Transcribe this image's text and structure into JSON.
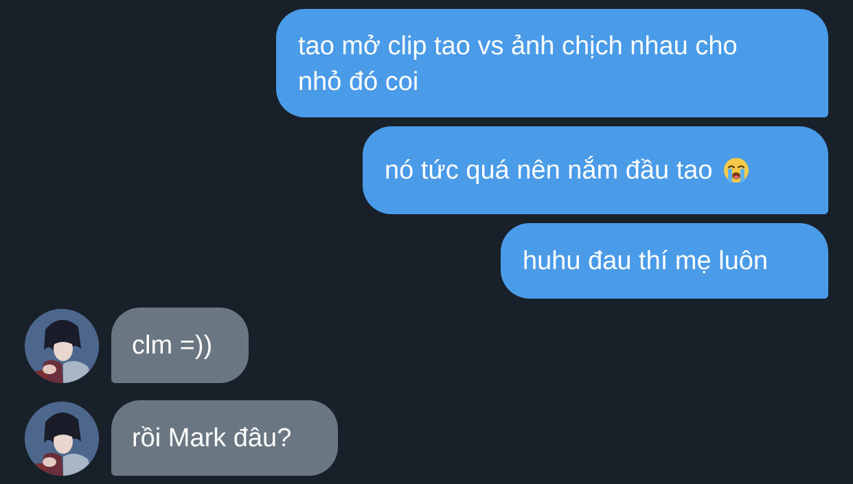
{
  "messages": {
    "out1": "tao mở clip tao vs ảnh chịch nhau cho nhỏ đó coi",
    "out2": "nó tức quá nên nắm đầu tao",
    "out2_emoji": "loudly-crying-face",
    "out3": "huhu đau thí mẹ luôn",
    "in1": "clm =))",
    "in2": "rồi Mark đâu?"
  },
  "colors": {
    "background": "#182029",
    "outgoing_bubble": "#4a9be8",
    "incoming_bubble": "#6a7682",
    "text": "#ffffff"
  }
}
